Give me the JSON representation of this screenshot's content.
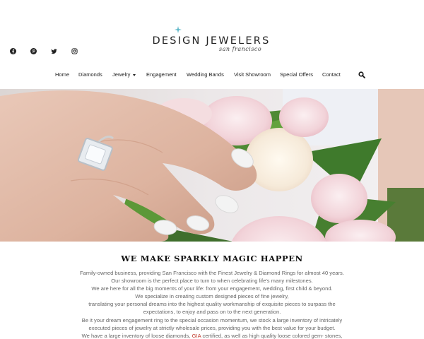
{
  "brand": {
    "name": "DESIGN JEWELERS",
    "tagline": "san francisco",
    "accent_color": "#5fb8c9"
  },
  "social": [
    {
      "icon": "facebook-icon"
    },
    {
      "icon": "pinterest-icon"
    },
    {
      "icon": "twitter-icon"
    },
    {
      "icon": "instagram-icon"
    }
  ],
  "nav": {
    "items": [
      {
        "label": "Home"
      },
      {
        "label": "Diamonds"
      },
      {
        "label": "Jewelry"
      },
      {
        "label": "Engagement"
      },
      {
        "label": "Wedding Bands"
      },
      {
        "label": "Visit Showroom"
      },
      {
        "label": "Special Offers"
      },
      {
        "label": "Contact"
      }
    ],
    "search_icon": "search-icon"
  },
  "main": {
    "headline": "WE MAKE SPARKLY MAGIC HAPPEN",
    "lines": [
      "Family-owned business, providing San Francisco with the Finest Jewelry & Diamond Rings for almost 40 years.",
      "Our showroom is the perfect place to turn to when celebrating life's many milestones.",
      "We are here for all the big moments of your life: from your engagement, wedding, first child & beyond.",
      "We specialize in creating custom designed pieces of fine jewelry,",
      "translating your personal dreams into the highest quality workmanship of exquisite pieces to surpass the",
      "expectations, to enjoy and pass on to the next generation.",
      "Be it your dream engagement ring to the special occasion momentum, we stock a large inventory of intricately",
      "executed pieces of jewelry at strictly wholesale prices, providing you with the best value for your budget."
    ],
    "last_line": {
      "before": "We have a large inventory of loose diamonds,",
      "highlight": "GIA",
      "after": "certified, as well as high quality loose colored gem- stones,"
    }
  }
}
